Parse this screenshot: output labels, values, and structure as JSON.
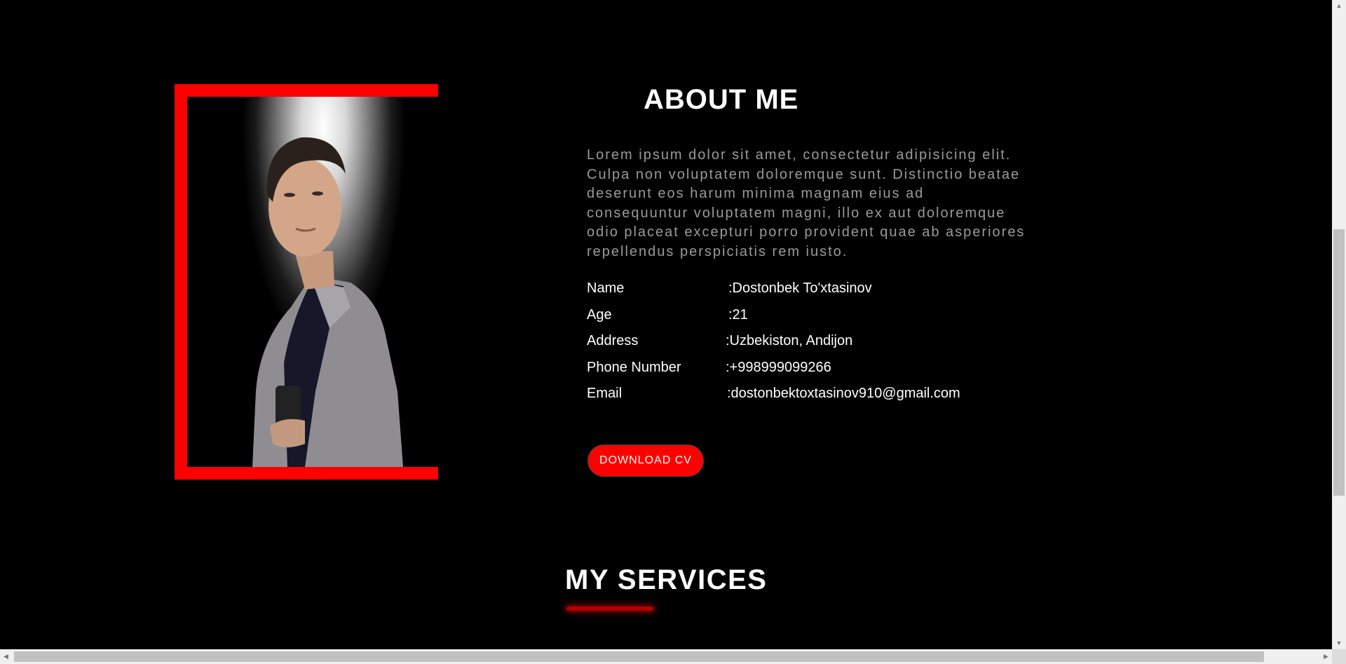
{
  "about": {
    "title": "ABOUT ME",
    "description": "Lorem ipsum dolor sit amet, consectetur adipisicing elit. Culpa non voluptatem doloremque sunt. Distinctio beatae deserunt eos harum minima magnam eius ad consequuntur voluptatem magni, illo ex aut doloremque odio placeat excepturi porro provident quae ab asperiores repellendus perspiciatis rem iusto.",
    "info": [
      {
        "label": "Name",
        "value": ":Dostonbek To'xtasinov"
      },
      {
        "label": "Age",
        "value": ":21"
      },
      {
        "label": "Address",
        "value": ":Uzbekiston, Andijon"
      },
      {
        "label": "Phone Number",
        "value": ":+998999099266"
      },
      {
        "label": "Email",
        "value": ":dostonbektoxtasinov910@gmail.com"
      }
    ],
    "download_label": "DOWNLOAD CV"
  },
  "services": {
    "title": "MY SERVICES"
  },
  "colors": {
    "accent": "#ff0000",
    "background": "#000000",
    "muted_text": "#9a9a9a"
  }
}
